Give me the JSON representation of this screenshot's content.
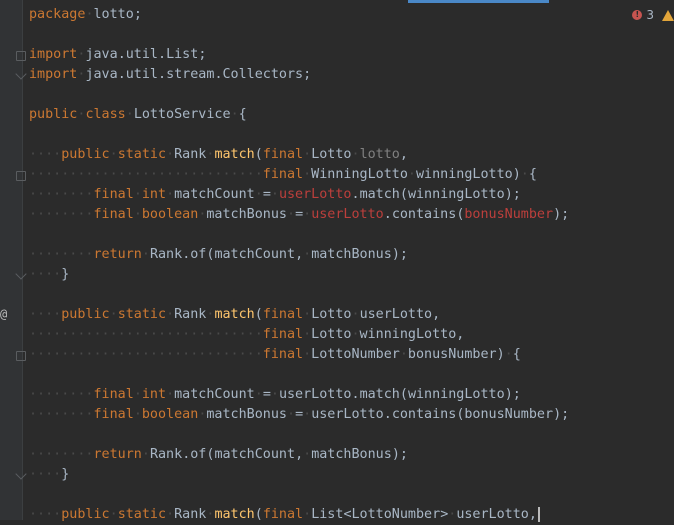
{
  "problems": {
    "error_count": "3"
  },
  "gutter": {
    "override_marker": "@"
  },
  "lines": [
    "package lotto;",
    "",
    "import java.util.List;",
    "import java.util.stream.Collectors;",
    "",
    "public class LottoService {",
    "",
    "    public static Rank match(final Lotto lotto,",
    "                             final WinningLotto winningLotto) {",
    "        final int matchCount = userLotto.match(winningLotto);",
    "        final boolean matchBonus = userLotto.contains(bonusNumber);",
    "",
    "        return Rank.of(matchCount, matchBonus);",
    "    }",
    "",
    "    public static Rank match(final Lotto userLotto,",
    "                             final Lotto winningLotto,",
    "                             final LottoNumber bonusNumber) {",
    "",
    "        final int matchCount = userLotto.match(winningLotto);",
    "        final boolean matchBonus = userLotto.contains(bonusNumber);",
    "",
    "        return Rank.of(matchCount, matchBonus);",
    "    }",
    "",
    "    public static Rank match(final List<LottoNumber> userLotto,"
  ],
  "colors": {
    "background": "#2b2b2b",
    "keyword": "#cc7832",
    "method": "#ffc66d",
    "text": "#a9b7c6",
    "unused_param": "#808080",
    "error_ref": "#bc3f3c",
    "tab_indicator": "#4a88c7"
  }
}
